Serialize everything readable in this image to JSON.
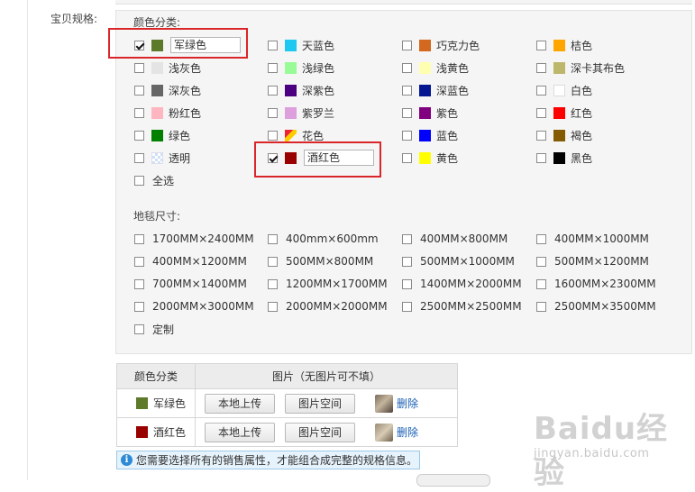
{
  "spec_label": "宝贝规格:",
  "color_group": {
    "title": "颜色分类:",
    "options": [
      {
        "label": "军绿色",
        "color": "#5c7a29",
        "checked": true,
        "editable": true
      },
      {
        "label": "天蓝色",
        "color": "#1ec8f0",
        "checked": false
      },
      {
        "label": "巧克力色",
        "color": "#d2691e",
        "checked": false
      },
      {
        "label": "桔色",
        "color": "#ffa500",
        "checked": false
      },
      {
        "label": "浅灰色",
        "color": "#e4e4e4",
        "checked": false
      },
      {
        "label": "浅绿色",
        "color": "#98fb98",
        "checked": false
      },
      {
        "label": "浅黄色",
        "color": "#ffffb1",
        "checked": false
      },
      {
        "label": "深卡其布色",
        "color": "#bdb76b",
        "checked": false
      },
      {
        "label": "深灰色",
        "color": "#666666",
        "checked": false
      },
      {
        "label": "深紫色",
        "color": "#4b0082",
        "checked": false
      },
      {
        "label": "深蓝色",
        "color": "#041690",
        "checked": false
      },
      {
        "label": "白色",
        "color": "#ffffff",
        "checked": false
      },
      {
        "label": "粉红色",
        "color": "#ffb6c1",
        "checked": false
      },
      {
        "label": "紫罗兰",
        "color": "#dda0dd",
        "checked": false
      },
      {
        "label": "紫色",
        "color": "#800080",
        "checked": false
      },
      {
        "label": "红色",
        "color": "#ff0000",
        "checked": false
      },
      {
        "label": "绿色",
        "color": "#008000",
        "checked": false
      },
      {
        "label": "花色",
        "color": "multi",
        "checked": false
      },
      {
        "label": "蓝色",
        "color": "#0000ff",
        "checked": false
      },
      {
        "label": "褐色",
        "color": "#855b00",
        "checked": false
      },
      {
        "label": "透明",
        "color": "transparent-pattern",
        "checked": false
      },
      {
        "label": "酒红色",
        "color": "#990000",
        "checked": true,
        "editable": true
      },
      {
        "label": "黄色",
        "color": "#ffff00",
        "checked": false
      },
      {
        "label": "黑色",
        "color": "#000000",
        "checked": false
      },
      {
        "label": "全选",
        "color": "",
        "checked": false
      }
    ]
  },
  "size_group": {
    "title": "地毯尺寸:",
    "options": [
      "1700MM×2400MM",
      "400mm×600mm",
      "400MM×800MM",
      "400MM×1000MM",
      "400MM×1200MM",
      "500MM×800MM",
      "500MM×1000MM",
      "500MM×1200MM",
      "700MM×1400MM",
      "1200MM×1700MM",
      "1400MM×2000MM",
      "1600MM×2300MM",
      "2000MM×3000MM",
      "2000MM×2000MM",
      "2500MM×2500MM",
      "2500MM×3500MM",
      "定制"
    ]
  },
  "image_table": {
    "header_color": "颜色分类",
    "header_image": "图片（无图片可不填）",
    "rows": [
      {
        "color_label": "军绿色",
        "swatch": "#5c7a29",
        "upload_label": "本地上传",
        "space_label": "图片空间",
        "delete_label": "删除"
      },
      {
        "color_label": "酒红色",
        "swatch": "#990000",
        "upload_label": "本地上传",
        "space_label": "图片空间",
        "delete_label": "删除"
      }
    ]
  },
  "notice": "您需要选择所有的销售属性，才能组合成完整的规格信息。",
  "watermark": {
    "main": "Baidu经验",
    "sub": "jingyan.baidu.com"
  }
}
